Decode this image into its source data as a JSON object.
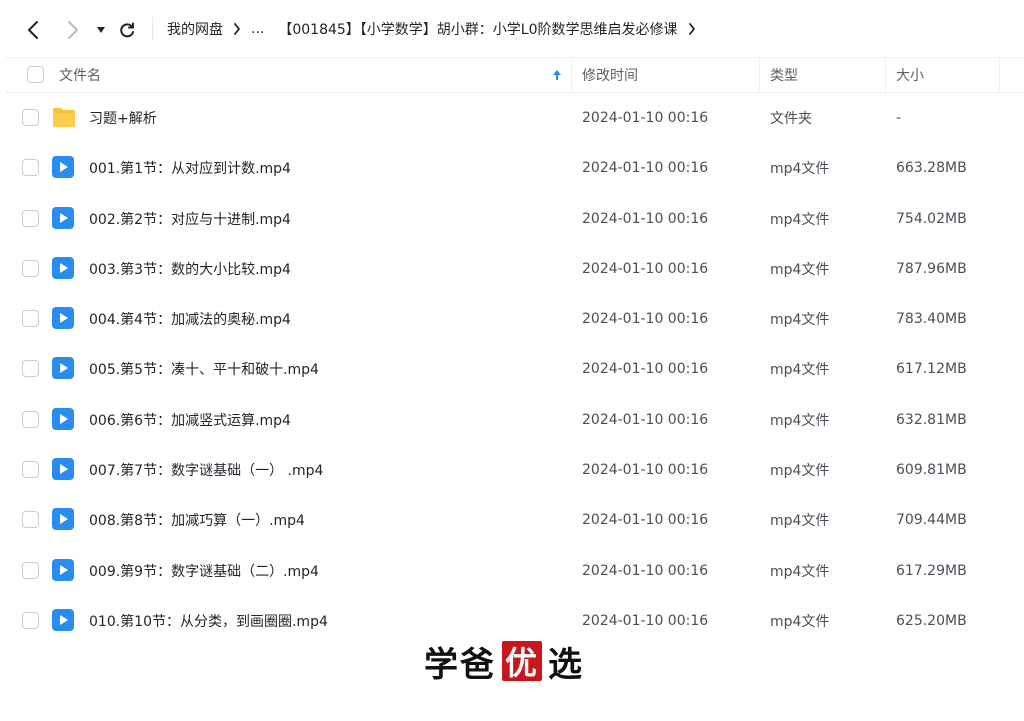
{
  "nav": {
    "back_icon": "chevron-left-icon",
    "forward_icon": "chevron-right-icon",
    "history_icon": "caret-down-icon",
    "refresh_icon": "refresh-icon"
  },
  "breadcrumb": {
    "root": "我的网盘",
    "ellipsis": "...",
    "current": "【001845】【小学数学】胡小群：小学L0阶数学思维启发必修课"
  },
  "header": {
    "name": "文件名",
    "modified": "修改时间",
    "type": "类型",
    "size": "大小",
    "sort_icon": "arrow-up-icon"
  },
  "colors": {
    "folder": "#f8c136",
    "video": "#2b8cf0",
    "watermark_box": "#c8161d"
  },
  "files": [
    {
      "name": "习题+解析",
      "modified": "2024-01-10 00:16",
      "type": "文件夹",
      "size": "-",
      "icon": "folder-icon"
    },
    {
      "name": "001.第1节：从对应到计数.mp4",
      "modified": "2024-01-10 00:16",
      "type": "mp4文件",
      "size": "663.28MB",
      "icon": "video-file-icon"
    },
    {
      "name": "002.第2节：对应与十进制.mp4",
      "modified": "2024-01-10 00:16",
      "type": "mp4文件",
      "size": "754.02MB",
      "icon": "video-file-icon"
    },
    {
      "name": "003.第3节：数的大小比较.mp4",
      "modified": "2024-01-10 00:16",
      "type": "mp4文件",
      "size": "787.96MB",
      "icon": "video-file-icon"
    },
    {
      "name": "004.第4节：加减法的奥秘.mp4",
      "modified": "2024-01-10 00:16",
      "type": "mp4文件",
      "size": "783.40MB",
      "icon": "video-file-icon"
    },
    {
      "name": "005.第5节：凑十、平十和破十.mp4",
      "modified": "2024-01-10 00:16",
      "type": "mp4文件",
      "size": "617.12MB",
      "icon": "video-file-icon"
    },
    {
      "name": "006.第6节：加减竖式运算.mp4",
      "modified": "2024-01-10 00:16",
      "type": "mp4文件",
      "size": "632.81MB",
      "icon": "video-file-icon"
    },
    {
      "name": "007.第7节：数字谜基础（一） .mp4",
      "modified": "2024-01-10 00:16",
      "type": "mp4文件",
      "size": "609.81MB",
      "icon": "video-file-icon"
    },
    {
      "name": "008.第8节：加减巧算（一）.mp4",
      "modified": "2024-01-10 00:16",
      "type": "mp4文件",
      "size": "709.44MB",
      "icon": "video-file-icon"
    },
    {
      "name": "009.第9节：数字谜基础（二）.mp4",
      "modified": "2024-01-10 00:16",
      "type": "mp4文件",
      "size": "617.29MB",
      "icon": "video-file-icon"
    },
    {
      "name": "010.第10节：从分类，到画圈圈.mp4",
      "modified": "2024-01-10 00:16",
      "type": "mp4文件",
      "size": "625.20MB",
      "icon": "video-file-icon"
    }
  ],
  "watermark": {
    "part1": "学爸",
    "box": "优",
    "part2": "选"
  }
}
